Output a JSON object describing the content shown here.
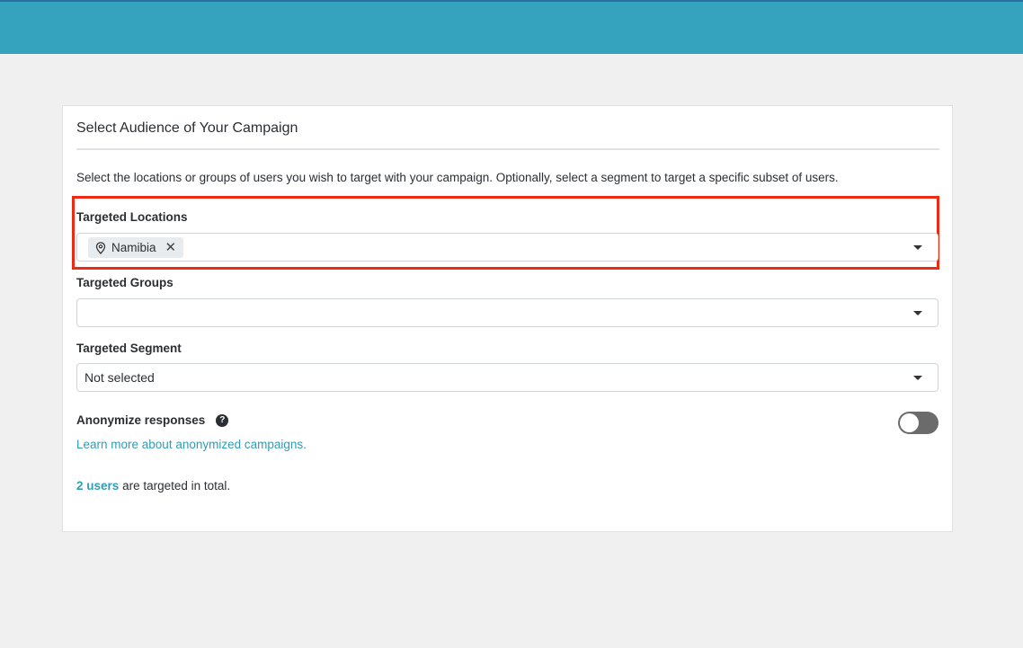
{
  "page": {
    "title": "Select Audience of Your Campaign",
    "description": "Select the locations or groups of users you wish to target with your campaign. Optionally, select a segment to target a specific subset of users."
  },
  "fields": {
    "locations": {
      "label": "Targeted Locations",
      "chips": [
        {
          "label": "Namibia",
          "icon": "map-pin-icon"
        }
      ]
    },
    "groups": {
      "label": "Targeted Groups",
      "value": ""
    },
    "segment": {
      "label": "Targeted Segment",
      "value": "Not selected"
    }
  },
  "anonymize": {
    "label": "Anonymize responses",
    "help_icon": "question-circle-icon",
    "link_text": "Learn more about anonymized campaigns.",
    "enabled": false
  },
  "summary": {
    "count_link": "2 users",
    "suffix": "are targeted in total."
  },
  "colors": {
    "accent": "#35a3bd",
    "link": "#2f9db5",
    "highlight": "#ee2a12"
  }
}
